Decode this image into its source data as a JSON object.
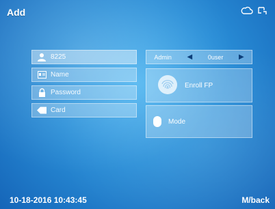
{
  "header": {
    "title": "Add",
    "icons": [
      "cloud-icon",
      "network-icon"
    ]
  },
  "form": {
    "user_id": "8225",
    "name_placeholder": "Name",
    "password_placeholder": "Password",
    "card_placeholder": "Card"
  },
  "role": {
    "left": "Admin",
    "right": "0user"
  },
  "enroll": {
    "label": "Enroll FP"
  },
  "mode": {
    "label": "Mode"
  },
  "footer": {
    "datetime": "10-18-2016 10:43:45",
    "back": "M/back"
  },
  "colors": {
    "background": "#2a8fd8",
    "text": "#ffffff"
  }
}
